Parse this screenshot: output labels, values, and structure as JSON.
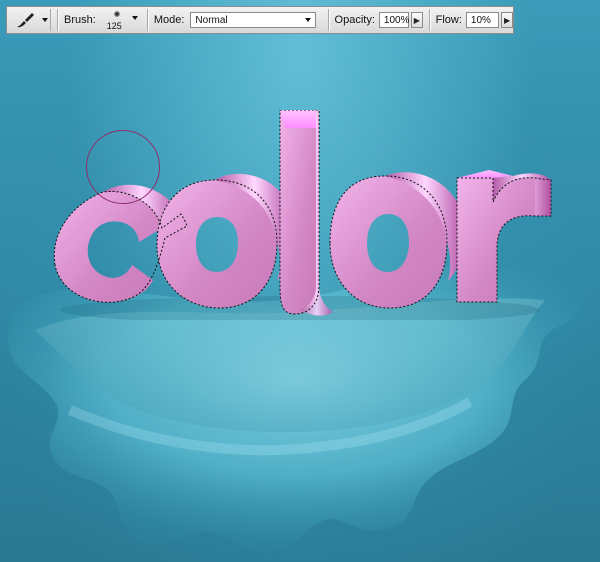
{
  "toolbar": {
    "brush_label": "Brush:",
    "brush_size": "125",
    "mode_label": "Mode:",
    "mode_value": "Normal",
    "opacity_label": "Opacity:",
    "opacity_value": "100%",
    "flow_label": "Flow:",
    "flow_value": "10%"
  },
  "icons": {
    "tool": "brush-icon",
    "dropdown": "chevron-down-icon",
    "stepper": "chevron-right-icon"
  },
  "colors": {
    "canvas_teal": "#2f8aa6",
    "text_pink": "#d78ac4",
    "text_highlight": "#ff9cff",
    "cursor_ring": "#8b2f6a"
  }
}
